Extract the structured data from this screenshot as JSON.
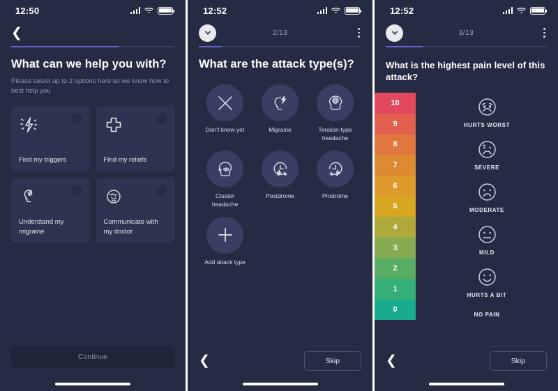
{
  "app": {
    "background_color": "#252b42",
    "accent_color": "#6b62c9",
    "card_color": "#2d3350"
  },
  "screens": [
    {
      "id": "help-selection",
      "status_bar": {
        "time": "12:50",
        "signal_icon": "signal-bars-icon",
        "wifi_icon": "wifi-icon",
        "battery_icon": "battery-icon"
      },
      "nav": {
        "back_icon": "chevron-left-icon"
      },
      "progress": {
        "percent": 66
      },
      "title": "What can we help you with?",
      "subtitle": "Please select up to 2 options here so we know how to best help you",
      "cards": [
        {
          "label": "Find my triggers",
          "icon": "lightning-bolt-icon"
        },
        {
          "label": "Find my reliefs",
          "icon": "medical-cross-icon"
        },
        {
          "label": "Understand my migraine",
          "icon": "head-profile-icon"
        },
        {
          "label": "Communicate with my doctor",
          "icon": "doctor-face-icon"
        }
      ],
      "primary_button": {
        "label": "Continue",
        "enabled": false
      }
    },
    {
      "id": "attack-types",
      "status_bar": {
        "time": "12:52",
        "signal_icon": "signal-bars-icon",
        "wifi_icon": "wifi-icon",
        "battery_icon": "battery-icon"
      },
      "nav": {
        "collapse_icon": "chevron-down-circle-icon",
        "step_counter": "2/13",
        "menu_icon": "kebab-menu-icon"
      },
      "progress": {
        "percent": 14
      },
      "title": "What are the attack type(s)?",
      "options": [
        {
          "label": "Don't know yet",
          "icon": "x-cross-icon"
        },
        {
          "label": "Migraine",
          "icon": "head-bolt-icon"
        },
        {
          "label": "Tension-type headache",
          "icon": "head-target-icon"
        },
        {
          "label": "Cluster headache",
          "icon": "head-eye-icon"
        },
        {
          "label": "Postdrome",
          "icon": "clock-bolt-after-icon"
        },
        {
          "label": "Prodrome",
          "icon": "clock-bolt-before-icon"
        },
        {
          "label": "Add attack type",
          "icon": "plus-icon"
        }
      ],
      "footer": {
        "back_icon": "chevron-left-icon",
        "skip_label": "Skip"
      }
    },
    {
      "id": "pain-level",
      "status_bar": {
        "time": "12:52",
        "signal_icon": "signal-bars-icon",
        "wifi_icon": "wifi-icon",
        "battery_icon": "battery-icon"
      },
      "nav": {
        "collapse_icon": "chevron-down-circle-icon",
        "step_counter": "3/13",
        "menu_icon": "kebab-menu-icon"
      },
      "progress": {
        "percent": 23
      },
      "title": "What is the highest pain level of this attack?",
      "pain_scale": {
        "levels": [
          {
            "value": "10",
            "color": "#e2495e"
          },
          {
            "value": "9",
            "color": "#e2604f"
          },
          {
            "value": "8",
            "color": "#e0773f"
          },
          {
            "value": "7",
            "color": "#dd8a33"
          },
          {
            "value": "6",
            "color": "#dc9b2c"
          },
          {
            "value": "5",
            "color": "#d9a621"
          },
          {
            "value": "4",
            "color": "#afa93c"
          },
          {
            "value": "3",
            "color": "#86ab50"
          },
          {
            "value": "2",
            "color": "#59ac63"
          },
          {
            "value": "1",
            "color": "#36ae78"
          },
          {
            "value": "0",
            "color": "#19ab8e"
          }
        ],
        "faces": [
          {
            "label": "HURTS WORST",
            "icon": "face-crying-icon"
          },
          {
            "label": "SEVERE",
            "icon": "face-very-sad-icon"
          },
          {
            "label": "MODERATE",
            "icon": "face-sad-icon"
          },
          {
            "label": "MILD",
            "icon": "face-neutral-icon"
          },
          {
            "label": "HURTS A BIT",
            "icon": "face-smile-icon"
          },
          {
            "label": "NO PAIN",
            "icon": "no-face-icon"
          }
        ]
      },
      "footer": {
        "back_icon": "chevron-left-icon",
        "skip_label": "Skip"
      }
    }
  ]
}
